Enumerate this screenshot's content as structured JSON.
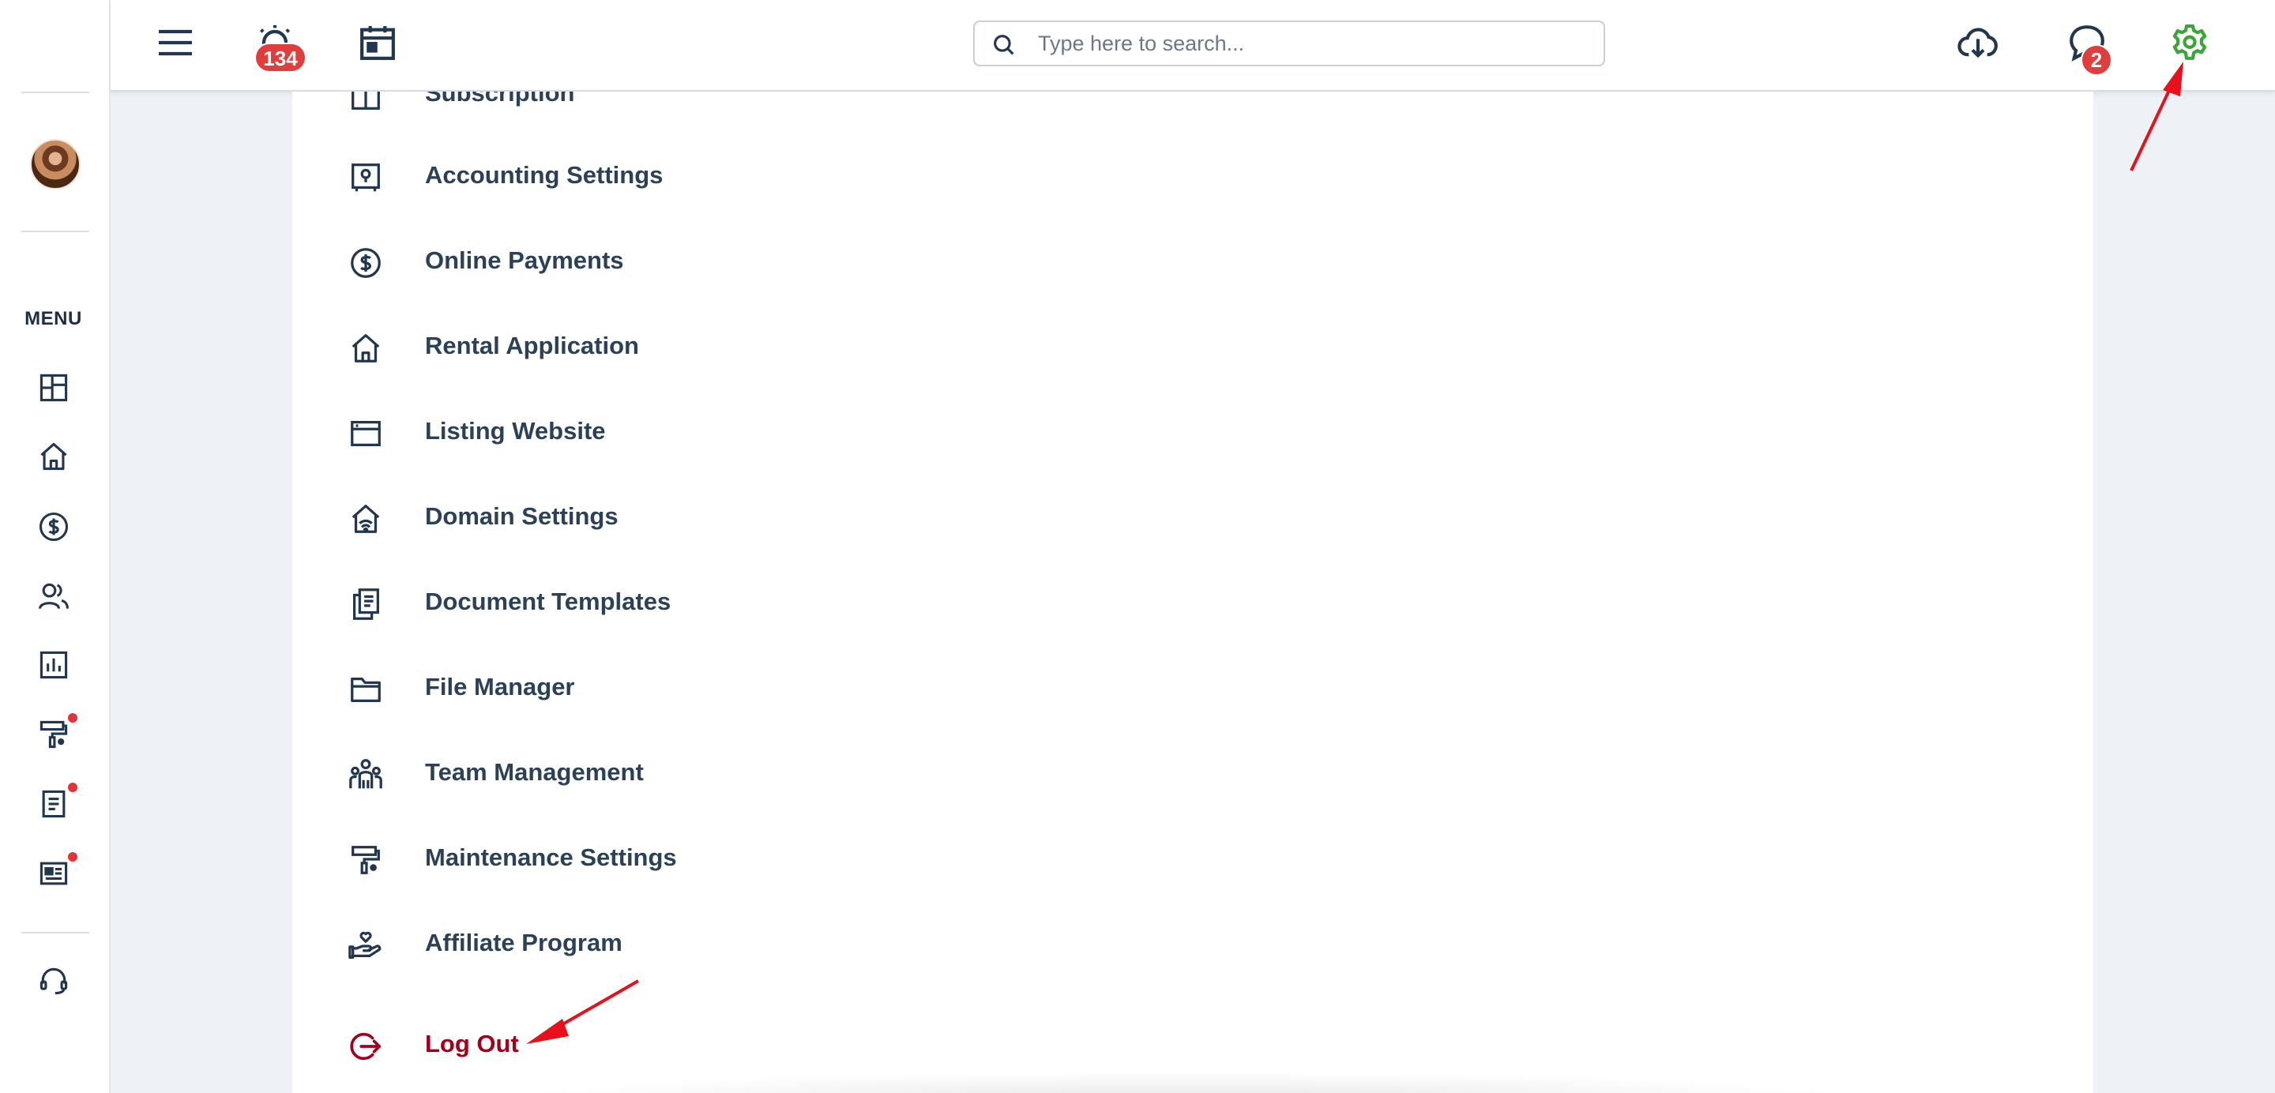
{
  "topbar": {
    "alarm_badge": "134",
    "chat_badge": "2",
    "search": {
      "placeholder": "Type here to search..."
    },
    "accent_color": "#3aa63a"
  },
  "sidebar": {
    "menu_label": "MENU",
    "icons": [
      "dashboard-icon",
      "home-icon",
      "dollar-icon",
      "users-icon",
      "report-icon",
      "paint-roller-icon",
      "document-icon",
      "news-icon",
      "headset-icon"
    ]
  },
  "settings_menu": {
    "items": [
      {
        "label": "Subscription",
        "icon": "subscription-icon"
      },
      {
        "label": "Accounting Settings",
        "icon": "safe-icon"
      },
      {
        "label": "Online Payments",
        "icon": "dollar-icon"
      },
      {
        "label": "Rental Application",
        "icon": "home-icon"
      },
      {
        "label": "Listing Website",
        "icon": "browser-icon"
      },
      {
        "label": "Domain Settings",
        "icon": "home-wifi-icon"
      },
      {
        "label": "Document Templates",
        "icon": "documents-icon"
      },
      {
        "label": "File Manager",
        "icon": "folder-icon"
      },
      {
        "label": "Team Management",
        "icon": "team-icon"
      },
      {
        "label": "Maintenance Settings",
        "icon": "paint-roller-icon"
      },
      {
        "label": "Affiliate Program",
        "icon": "hand-heart-icon"
      },
      {
        "label": "Log Out",
        "icon": "logout-icon"
      }
    ]
  },
  "colors": {
    "logout": "#a3001b",
    "badge": "#e03d3d",
    "annotation_arrow": "#e8101a"
  }
}
